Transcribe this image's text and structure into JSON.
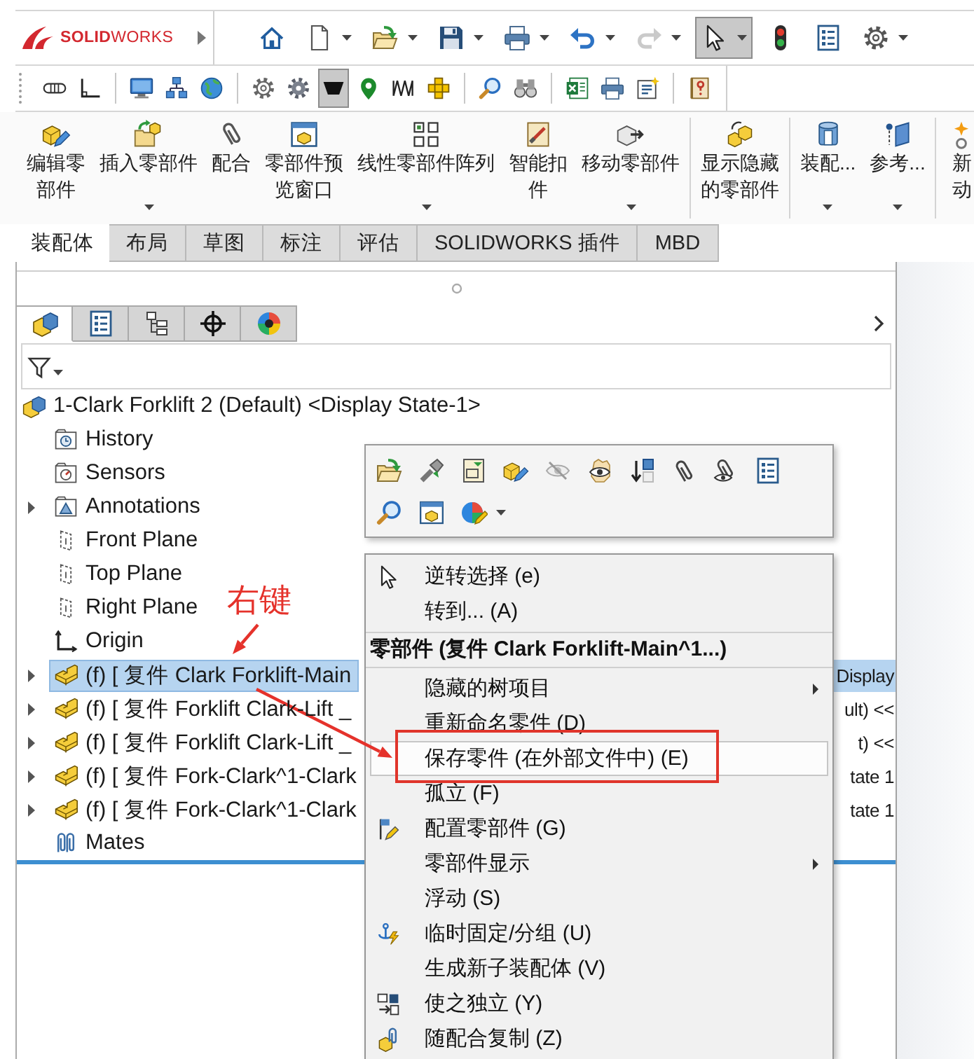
{
  "header": {
    "logo": "**SOLID**WORKS",
    "quick_access": [
      {
        "dropdown": false,
        "disabled": false,
        "pressed": false
      },
      {
        "dropdown": true,
        "disabled": false,
        "pressed": false
      },
      {
        "dropdown": true,
        "disabled": false,
        "pressed": false
      },
      {
        "dropdown": true,
        "disabled": false,
        "pressed": false
      },
      {
        "dropdown": true,
        "disabled": false,
        "pressed": false
      },
      {
        "dropdown": true,
        "disabled": false,
        "pressed": false
      },
      {
        "dropdown": true,
        "disabled": true,
        "pressed": false
      },
      {
        "dropdown": true,
        "disabled": false,
        "pressed": true
      },
      {
        "dropdown": false,
        "disabled": false,
        "pressed": false
      },
      {
        "dropdown": false,
        "disabled": false,
        "pressed": false
      },
      {
        "dropdown": true,
        "disabled": false,
        "pressed": false
      }
    ],
    "toolbar_groups": [
      [
        {
          "pressed": false
        },
        {
          "pressed": false
        }
      ],
      [
        {
          "pressed": false
        },
        {
          "pressed": false
        },
        {
          "pressed": false
        }
      ],
      [
        {
          "pressed": false
        },
        {
          "pressed": false
        },
        {
          "pressed": true
        },
        {
          "pressed": false
        },
        {
          "pressed": false
        },
        {
          "pressed": false
        }
      ],
      [
        {
          "pressed": false
        },
        {
          "pressed": false
        }
      ],
      [
        {
          "pressed": false
        },
        {
          "pressed": false
        },
        {
          "pressed": false
        }
      ],
      [
        {
          "pressed": false
        }
      ]
    ]
  },
  "ribbon": {
    "groups": [
      [
        {
          "lines": [
            "编辑零",
            "部件"
          ],
          "dropdown": false
        },
        {
          "lines": [
            "插入零部件"
          ],
          "dropdown": true
        },
        {
          "lines": [
            "配合"
          ],
          "dropdown": false
        },
        {
          "lines": [
            "零部件预",
            "览窗口"
          ],
          "dropdown": false
        },
        {
          "lines": [
            "线性零部件阵列"
          ],
          "dropdown": true
        },
        {
          "lines": [
            "智能扣",
            "件"
          ],
          "dropdown": false
        },
        {
          "lines": [
            "移动零部件"
          ],
          "dropdown": true
        }
      ],
      [
        {
          "lines": [
            "显示隐藏",
            "的零部件"
          ],
          "dropdown": false
        }
      ],
      [
        {
          "lines": [
            "装配..."
          ],
          "dropdown": true
        },
        {
          "lines": [
            "参考..."
          ],
          "dropdown": true
        }
      ],
      [
        {
          "lines": [
            "新",
            "动"
          ],
          "dropdown": false
        }
      ]
    ]
  },
  "command_tabs": [
    {
      "label": "装配体",
      "selected": true
    },
    {
      "label": "布局",
      "selected": false
    },
    {
      "label": "草图",
      "selected": false
    },
    {
      "label": "标注",
      "selected": false
    },
    {
      "label": "评估",
      "selected": false
    },
    {
      "label": "SOLIDWORKS 插件",
      "selected": false
    },
    {
      "label": "MBD",
      "selected": false
    }
  ],
  "panel": {
    "tabs": [
      {
        "selected": true
      },
      {
        "selected": false
      },
      {
        "selected": false
      },
      {
        "selected": false
      },
      {
        "selected": false
      }
    ],
    "tree": {
      "kind": "assembly",
      "label": "1-Clark Forklift 2 (Default) <Display State-1>",
      "selected": false,
      "children": [
        {
          "kind": "history",
          "label": "History",
          "expandable": false,
          "selected": false
        },
        {
          "kind": "sensors",
          "label": "Sensors",
          "expandable": false,
          "selected": false
        },
        {
          "kind": "annotations",
          "label": "Annotations",
          "expandable": true,
          "selected": false
        },
        {
          "kind": "plane",
          "label": "Front Plane",
          "expandable": false,
          "selected": false
        },
        {
          "kind": "plane",
          "label": "Top Plane",
          "expandable": false,
          "selected": false
        },
        {
          "kind": "plane",
          "label": "Right Plane",
          "expandable": false,
          "selected": false
        },
        {
          "kind": "origin",
          "label": "Origin",
          "expandable": false,
          "selected": false
        },
        {
          "kind": "component",
          "label": "(f) [ 复件 Clark Forklift-Main",
          "label_tail": "Display",
          "expandable": true,
          "selected": true
        },
        {
          "kind": "component",
          "label": "(f) [ 复件 Forklift Clark-Lift _",
          "label_tail": "ult) <<",
          "expandable": true,
          "selected": false
        },
        {
          "kind": "component",
          "label": "(f) [ 复件 Forklift Clark-Lift _",
          "label_tail": "t) <<",
          "expandable": true,
          "selected": false
        },
        {
          "kind": "component",
          "label": "(f) [ 复件 Fork-Clark^1-Clark",
          "label_tail": "tate 1",
          "expandable": true,
          "selected": false
        },
        {
          "kind": "component",
          "label": "(f) [ 复件 Fork-Clark^1-Clark",
          "label_tail": "tate 1",
          "expandable": true,
          "selected": false
        },
        {
          "kind": "mates",
          "label": "Mates",
          "expandable": false,
          "selected": false
        }
      ]
    }
  },
  "context_toolbar": {
    "rows": [
      [
        {
          "dropdown": false
        },
        {
          "dropdown": false
        },
        {
          "dropdown": false
        },
        {
          "dropdown": false
        },
        {
          "dropdown": false
        },
        {
          "dropdown": false
        },
        {
          "dropdown": false
        },
        {
          "dropdown": false
        },
        {
          "dropdown": false
        },
        {
          "dropdown": false
        }
      ],
      [
        {
          "dropdown": false
        },
        {
          "dropdown": false
        },
        {
          "dropdown": true
        }
      ]
    ]
  },
  "context_menu": {
    "items": [
      {
        "kind": "command",
        "label": "逆转选择 (e)",
        "submenu": false,
        "highlighted": false
      },
      {
        "kind": "command",
        "label": "转到... (A)",
        "submenu": false,
        "highlighted": false
      },
      {
        "kind": "separator"
      },
      {
        "kind": "header",
        "label": "零部件 (复件 Clark Forklift-Main^1...)"
      },
      {
        "kind": "separator"
      },
      {
        "kind": "command",
        "label": "隐藏的树项目",
        "submenu": true,
        "highlighted": false
      },
      {
        "kind": "command",
        "label": "重新命名零件 (D)",
        "submenu": false,
        "highlighted": false
      },
      {
        "kind": "command",
        "label": "保存零件 (在外部文件中) (E)",
        "submenu": false,
        "highlighted": true
      },
      {
        "kind": "command",
        "label": "孤立 (F)",
        "submenu": false,
        "highlighted": false
      },
      {
        "kind": "command",
        "label": "配置零部件 (G)",
        "submenu": false,
        "highlighted": false
      },
      {
        "kind": "command",
        "label": "零部件显示",
        "submenu": true,
        "highlighted": false
      },
      {
        "kind": "command",
        "label": "浮动 (S)",
        "submenu": false,
        "highlighted": false
      },
      {
        "kind": "command",
        "label": "临时固定/分组 (U)",
        "submenu": false,
        "highlighted": false
      },
      {
        "kind": "command",
        "label": "生成新子装配体 (V)",
        "submenu": false,
        "highlighted": false
      },
      {
        "kind": "command",
        "label": "使之独立 (Y)",
        "submenu": false,
        "highlighted": false
      },
      {
        "kind": "command",
        "label": "随配合复制 (Z)",
        "submenu": false,
        "highlighted": false
      }
    ]
  },
  "annotation": {
    "label": "右键"
  }
}
